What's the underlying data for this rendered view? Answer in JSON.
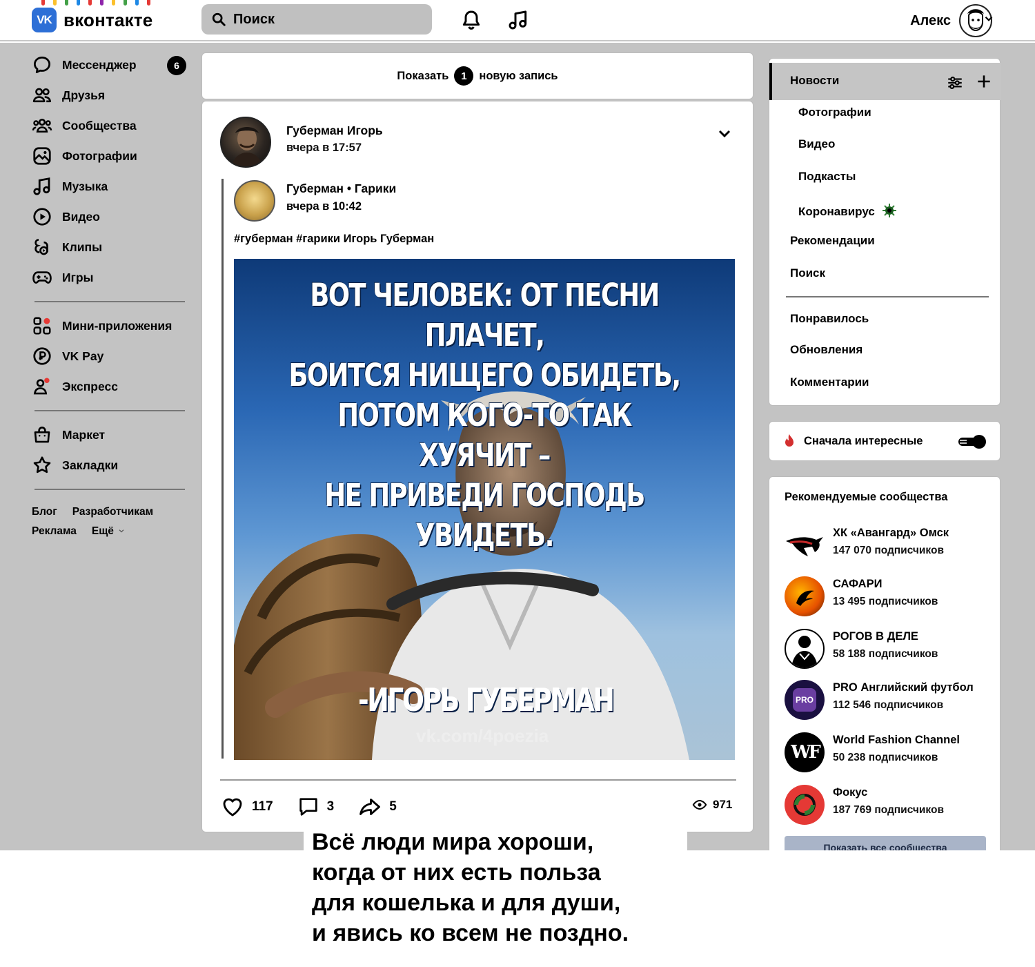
{
  "header": {
    "logo_mark": "VK",
    "logo_text": "вконтакте",
    "search_placeholder": "Поиск",
    "user_name": "Алекс",
    "garland_colors": [
      "#e53935",
      "#fbc02d",
      "#43a047",
      "#1e88e5",
      "#e53935",
      "#8e24aa",
      "#fbc02d",
      "#43a047",
      "#1e88e5",
      "#e53935"
    ]
  },
  "sidebar": {
    "items": [
      {
        "label": "Мессенджер",
        "icon": "chat-icon",
        "badge": "6"
      },
      {
        "label": "Друзья",
        "icon": "friends-icon"
      },
      {
        "label": "Сообщества",
        "icon": "communities-icon"
      },
      {
        "label": "Фотографии",
        "icon": "photo-icon"
      },
      {
        "label": "Музыка",
        "icon": "music-icon"
      },
      {
        "label": "Видео",
        "icon": "video-icon"
      },
      {
        "label": "Клипы",
        "icon": "clips-icon"
      },
      {
        "label": "Игры",
        "icon": "gamepad-icon"
      }
    ],
    "items2": [
      {
        "label": "Мини-приложения",
        "icon": "apps-icon"
      },
      {
        "label": "VK Pay",
        "icon": "vkpay-icon"
      },
      {
        "label": "Экспресс",
        "icon": "express-icon"
      }
    ],
    "items3": [
      {
        "label": "Маркет",
        "icon": "market-icon"
      },
      {
        "label": "Закладки",
        "icon": "star-icon"
      }
    ],
    "footer": {
      "blog": "Блог",
      "dev": "Разработчикам",
      "ads": "Реклама",
      "more": "Ещё"
    }
  },
  "feed": {
    "show_new_prefix": "Показать",
    "show_new_count": "1",
    "show_new_suffix": "новую запись",
    "post": {
      "author": "Губерман Игорь",
      "time": "вчера в 17:57",
      "repost_author": "Губерман • Гарики",
      "repost_time": "вчера в 10:42",
      "tags": "#губерман #гарики Игорь Губерман",
      "image_quote": [
        "ВОТ ЧЕЛОВЕК: ОТ ПЕСНИ ПЛАЧЕТ,",
        "БОИТСЯ НИЩЕГО ОБИДЕТЬ,",
        "ПОТОМ КОГО-ТО ТАК ХУЯЧИТ –",
        "НЕ ПРИВЕДИ ГОСПОДЬ УВИДЕТЬ."
      ],
      "image_author": "-ИГОРЬ ГУБЕРМАН",
      "image_watermark": "vk.com/4poezia",
      "likes": "117",
      "comments": "3",
      "shares": "5",
      "views": "971"
    }
  },
  "right_menu": {
    "active": "Новости",
    "subitems": [
      "Фотографии",
      "Видео",
      "Подкасты",
      "Коронавирус"
    ],
    "items": [
      "Рекомендации",
      "Поиск"
    ],
    "items2": [
      "Понравилось",
      "Обновления",
      "Комментарии"
    ]
  },
  "interesting": {
    "label": "Сначала интересные",
    "enabled": true
  },
  "recommended": {
    "title": "Рекомендуемые сообщества",
    "groups": [
      {
        "name": "ХК «Авангард» Омск",
        "subs": "147 070 подписчиков"
      },
      {
        "name": "САФАРИ",
        "subs": "13 495 подписчиков"
      },
      {
        "name": "РОГОВ В ДЕЛЕ",
        "subs": "58 188 подписчиков"
      },
      {
        "name": "PRO Английский футбол",
        "subs": "112 546 подписчиков"
      },
      {
        "name": "World Fashion Channel",
        "subs": "50 238 подписчиков"
      },
      {
        "name": "Фокус",
        "subs": "187 769 подписчиков"
      }
    ],
    "show_all": "Показать все сообщества",
    "avatar_texts": [
      "PRO",
      "WF"
    ]
  },
  "caption": {
    "lines": [
      "Всё люди мира хороши,",
      "когда от них есть польза",
      "для кошелька и для души,",
      "и явись ко всем не поздно."
    ]
  }
}
